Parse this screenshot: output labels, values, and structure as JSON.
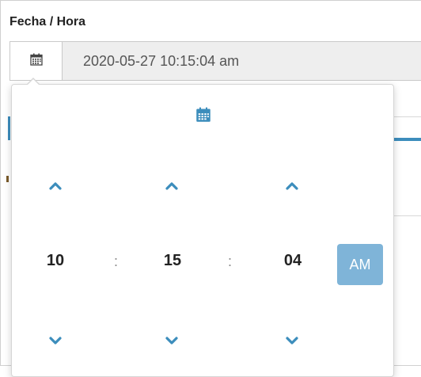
{
  "field": {
    "label": "Fecha / Hora",
    "value": "2020-05-27 10:15:04 am",
    "addon_icon": "calendar-icon"
  },
  "picker": {
    "toggle_icon": "calendar-icon",
    "hours": "10",
    "minutes": "15",
    "seconds": "04",
    "separator": ":",
    "period": "AM",
    "increment_icon": "chevron-up-icon",
    "decrement_icon": "chevron-down-icon"
  },
  "colors": {
    "accent": "#3c8dbc",
    "period_button": "#7fb4d8",
    "input_bg": "#eeeeee"
  }
}
